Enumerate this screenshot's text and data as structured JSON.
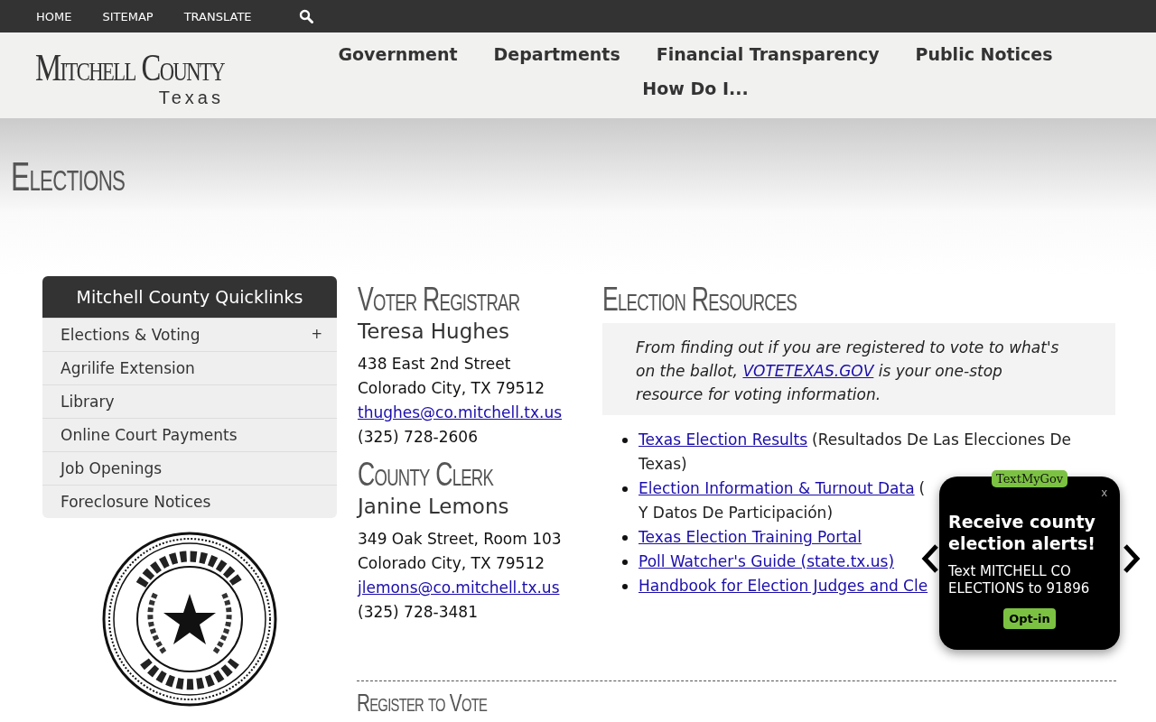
{
  "top_bar": {
    "links": [
      "HOME",
      "SITEMAP",
      "TRANSLATE"
    ]
  },
  "header": {
    "logo": {
      "name": "Mitchell County",
      "state": "Texas"
    },
    "nav": [
      "Government",
      "Departments",
      "Financial Transparency",
      "Public Notices",
      "How Do I..."
    ]
  },
  "page_title": "Elections",
  "quicklinks": {
    "title": "Mitchell County Quicklinks",
    "items": [
      {
        "label": "Elections & Voting",
        "expander": "+"
      },
      {
        "label": "Agrilife Extension"
      },
      {
        "label": "Library"
      },
      {
        "label": "Online Court Payments"
      },
      {
        "label": "Job Openings"
      },
      {
        "label": "Foreclosure Notices"
      }
    ]
  },
  "contacts": [
    {
      "title": "Voter Registrar",
      "name": "Teresa Hughes",
      "lines": [
        "438 East 2nd Street",
        "Colorado City, TX 79512"
      ],
      "email": "thughes@co.mitchell.tx.us",
      "phone": "(325) 728-2606"
    },
    {
      "title": "County Clerk",
      "name": "Janine Lemons",
      "lines": [
        "349 Oak Street, Room 103",
        "Colorado City, TX 79512"
      ],
      "email": "jlemons@co.mitchell.tx.us",
      "phone": "(325) 728-3481"
    }
  ],
  "resources": {
    "title": "Election Resources",
    "intro": {
      "before": "From finding out if you are registered to vote to what's on the ballot,",
      "link": "VOTETEXAS.GOV",
      "after": "is your one-stop resource for voting information."
    },
    "links": [
      {
        "link": "Texas Election Results",
        "note": "(Resultados De Las Elecciones De Texas)"
      },
      {
        "link": "Election Information & Turnout Data",
        "note": "(",
        "note_next_line": "Y Datos De Participación)"
      },
      {
        "link": "Texas Election Training Portal"
      },
      {
        "link": "Poll Watcher's Guide (state.tx.us)"
      },
      {
        "link": "Handbook for Election Judges and Cle"
      }
    ]
  },
  "next_section": "Register to Vote",
  "popup": {
    "brand": "TextMyGov",
    "close": "x",
    "title": "Receive county election alerts!",
    "message": "Text MITCHELL CO ELECTIONS to 91896",
    "button": "Opt-in"
  }
}
